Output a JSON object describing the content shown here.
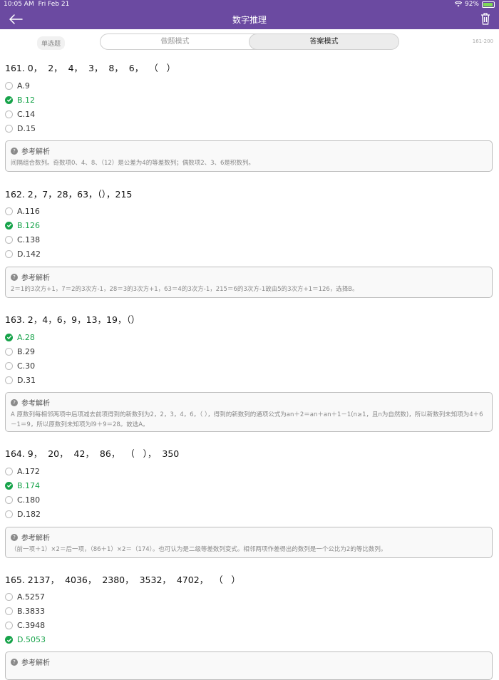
{
  "status": {
    "time": "10:05 AM",
    "date": "Fri Feb 21",
    "battery": "92%",
    "battery_level": 0.92
  },
  "nav": {
    "title": "数字推理"
  },
  "modes": {
    "type_badge": "单选题",
    "practice": "做题模式",
    "answer": "答案模式",
    "range": "161-200"
  },
  "questions": [
    {
      "title": "161. 0，  2，  4，  3，  8，  6，  （   ）",
      "options": [
        "A.9",
        "B.12",
        "C.14",
        "D.15"
      ],
      "correct": 1,
      "expl_head": "参考解析",
      "expl": "间隔组合数列。奇数项0、4、8、（12）是公差为4的等差数列；偶数项2、3、6是积数列。"
    },
    {
      "title": "162. 2，7，28，63，（），215",
      "options": [
        "A.116",
        "B.126",
        "C.138",
        "D.142"
      ],
      "correct": 1,
      "expl_head": "参考解析",
      "expl": "2＝1的3次方+1，7＝2的3次方-1，28＝3的3次方+1，63＝4的3次方-1，215＝6的3次方-1故由5的3次方+1＝126，选择B。"
    },
    {
      "title": "163. 2，4，6，9，13，19，（）",
      "options": [
        "A.28",
        "B.29",
        "C.30",
        "D.31"
      ],
      "correct": 0,
      "expl_head": "参考解析",
      "expl": "A 原数列每相邻两项中后项减去前项得到的新数列为2，2，3，4，6，（  ），得到的新数列的通项公式为an＋2＝an＋an＋1－1(n≥1，且n为自然数)，所以新数列未知项为4＋6－1＝9，所以原数列未知项为l9＋9＝28。故选A。"
    },
    {
      "title": "164. 9，  20，  42，  86，  （   ），  350",
      "options": [
        "A.172",
        "B.174",
        "C.180",
        "D.182"
      ],
      "correct": 1,
      "expl_head": "参考解析",
      "expl": "（前一项＋1）×2＝后一项，（86＋1）×2＝（174）。也可认为是二级等差数列变式。相邻两项作差得出的数列是一个公比为2的等比数列。"
    },
    {
      "title": "165. 2137，  4036，  2380，  3532，  4702，  （   ）",
      "options": [
        "A.5257",
        "B.3833",
        "C.3948",
        "D.5053"
      ],
      "correct": 3,
      "expl_head": "参考解析",
      "expl": ""
    }
  ]
}
